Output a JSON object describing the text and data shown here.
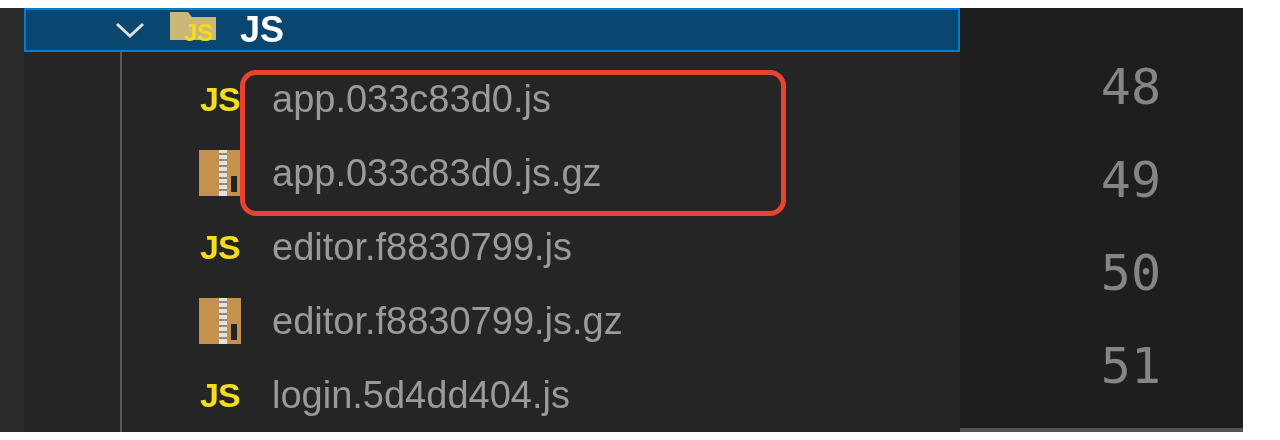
{
  "explorer": {
    "folder": {
      "name": "JS",
      "icon_text": "JS",
      "expanded": true,
      "selected": true
    },
    "files": [
      {
        "name": "app.033c83d0.js",
        "kind": "js",
        "icon_text": "JS"
      },
      {
        "name": "app.033c83d0.js.gz",
        "kind": "zip"
      },
      {
        "name": "editor.f8830799.js",
        "kind": "js",
        "icon_text": "JS"
      },
      {
        "name": "editor.f8830799.js.gz",
        "kind": "zip"
      },
      {
        "name": "login.5d4dd404.js",
        "kind": "js",
        "icon_text": "JS"
      }
    ]
  },
  "editor": {
    "line_numbers": [
      "48",
      "49",
      "50",
      "51"
    ]
  }
}
